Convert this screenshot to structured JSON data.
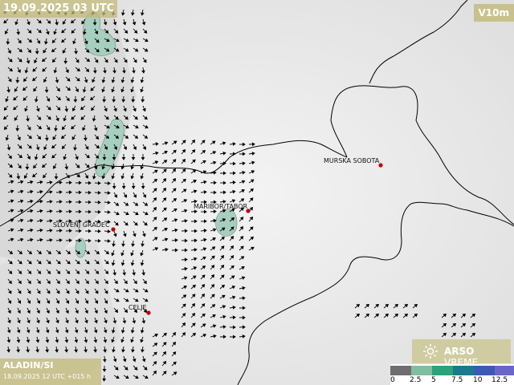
{
  "valid_time": "19.09.2025 03 UTC",
  "variable": "V10m",
  "model": {
    "name": "ALADIN/SI",
    "run": "18.09.2025 12 UTC +015 h"
  },
  "brand": {
    "bold": "ARSO",
    "rest": " VREME"
  },
  "cities": [
    {
      "name": "MURSKA SOBOTA"
    },
    {
      "name": "MARIBOR/TABOR"
    },
    {
      "name": "SLOVENJ GRADEC"
    },
    {
      "name": "CELJE"
    }
  ],
  "legend": {
    "ticks": [
      "0",
      "2.5",
      "5",
      "7.5",
      "10",
      "12.5"
    ],
    "colors": [
      "#6e6e6e",
      "#7fbf9f",
      "#2aa37a",
      "#1a7a8c",
      "#3a5ab5",
      "#6a66c8"
    ]
  },
  "colors": {
    "city_marker": "#c00000",
    "border": "#000000",
    "vector": "#000000",
    "wind_shading": "#a7cfc0"
  }
}
